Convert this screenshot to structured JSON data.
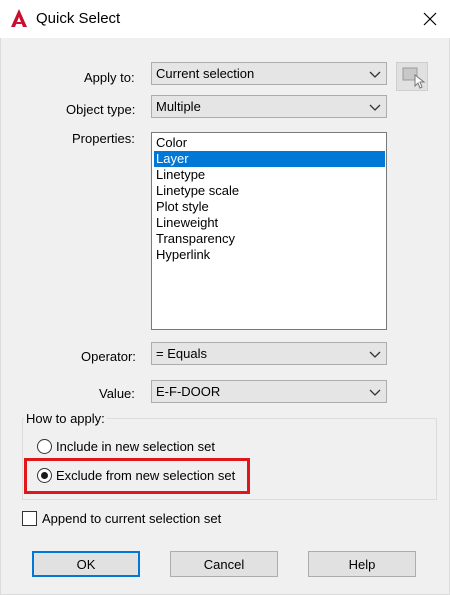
{
  "window": {
    "title": "Quick Select",
    "app_icon": "autocad-a-icon",
    "close_icon": "close-x-icon"
  },
  "apply_to": {
    "label": "Apply to:",
    "value": "Current selection",
    "pick_icon": "select-objects-icon"
  },
  "object_type": {
    "label": "Object type:",
    "value": "Multiple"
  },
  "properties": {
    "label": "Properties:",
    "items": [
      "Color",
      "Layer",
      "Linetype",
      "Linetype scale",
      "Plot style",
      "Lineweight",
      "Transparency",
      "Hyperlink"
    ],
    "selected": "Layer"
  },
  "operator": {
    "label": "Operator:",
    "value": "= Equals"
  },
  "value": {
    "label": "Value:",
    "value": "E-F-DOOR"
  },
  "how_to_apply": {
    "title": "How to apply:",
    "include_label": "Include in new selection set",
    "exclude_label": "Exclude from new selection set",
    "selected": "exclude"
  },
  "append": {
    "label": "Append to current selection set",
    "checked": false
  },
  "buttons": {
    "ok": "OK",
    "cancel": "Cancel",
    "help": "Help"
  },
  "colors": {
    "accent": "#0078d7",
    "highlight_box": "#e0161b",
    "app_icon": "#c8102e"
  }
}
